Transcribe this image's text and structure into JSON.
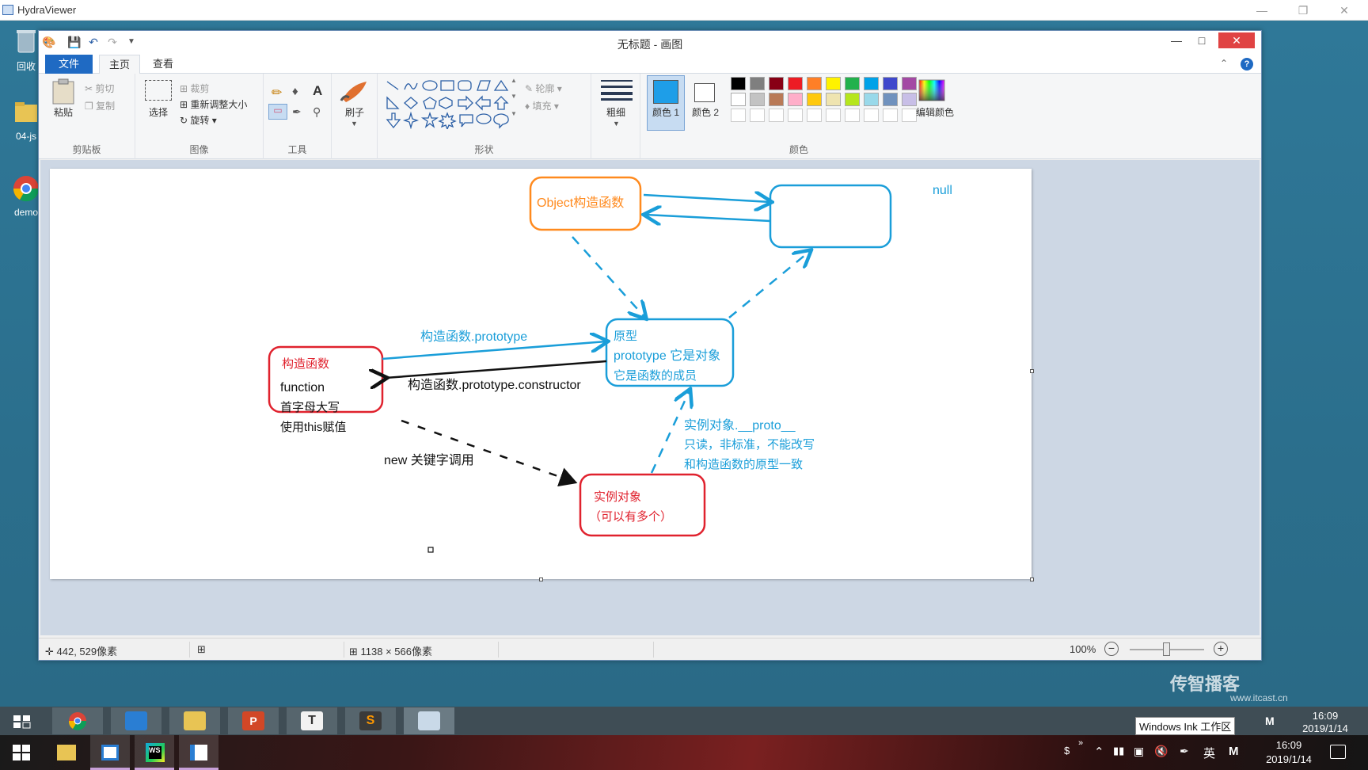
{
  "viewer": {
    "title": "HydraViewer"
  },
  "desktop": {
    "icons": [
      {
        "label": "回收"
      },
      {
        "label": "04-js"
      },
      {
        "label": "demo"
      }
    ],
    "watermark": {
      "logo": "传智播客",
      "url": "www.itcast.cn"
    }
  },
  "paint": {
    "title": "无标题 - 画图",
    "tabs": {
      "file": "文件",
      "home": "主页",
      "view": "查看"
    },
    "ribbon": {
      "clipboard": {
        "paste": "粘贴",
        "cut": "剪切",
        "copy": "复制",
        "label": "剪贴板"
      },
      "image": {
        "select": "选择",
        "crop": "裁剪",
        "resize": "重新调整大小",
        "rotate": "旋转",
        "label": "图像"
      },
      "tools": {
        "label": "工具"
      },
      "brushes": {
        "label": "刷子"
      },
      "shapes": {
        "outline": "轮廓",
        "fill": "填充",
        "label": "形状"
      },
      "size": {
        "label": "粗细"
      },
      "colors": {
        "color1": "颜色 1",
        "color2": "颜色 2",
        "edit": "编辑颜色",
        "label": "颜色",
        "color1_value": "#1e9ee8",
        "color2_value": "#ffffff",
        "row1": [
          "#000000",
          "#7f7f7f",
          "#880015",
          "#ed1c24",
          "#ff7f27",
          "#fff200",
          "#22b14c",
          "#00a2e8",
          "#3f48cc",
          "#a349a4"
        ],
        "row2": [
          "#ffffff",
          "#c3c3c3",
          "#b97a57",
          "#ffaec9",
          "#ffc90e",
          "#efe4b0",
          "#b5e61d",
          "#99d9ea",
          "#7092be",
          "#c8bfe7"
        ]
      }
    },
    "diagram": {
      "object_constructor": "Object构造函数",
      "null_label": "null",
      "prototype_edge": "构造函数.prototype",
      "constructor_edge": "构造函数.prototype.constructor",
      "constructor_box": {
        "title": "构造函数",
        "line1": "function",
        "line2": "首字母大写",
        "line3": "使用this赋值"
      },
      "prototype_box": {
        "line1": "原型",
        "line2": "prototype 它是对象",
        "line3": "它是函数的成员"
      },
      "new_edge": "new 关键字调用",
      "proto_edge": {
        "line1": "实例对象.__proto__",
        "line2": "只读，非标准，不能改写",
        "line3": "和构造函数的原型一致"
      },
      "instance_box": {
        "line1": "实例对象",
        "line2": "（可以有多个）"
      }
    },
    "status": {
      "cursor": "442, 529像素",
      "canvas_size": "1138 × 566像素",
      "zoom": "100%"
    }
  },
  "taskbar_hv": {
    "ink_tooltip": "Windows Ink 工作区",
    "time": "16:09",
    "date": "2019/1/14"
  },
  "taskbar_win": {
    "ime": "英",
    "ime2": "M",
    "time": "16:09",
    "date": "2019/1/14"
  }
}
